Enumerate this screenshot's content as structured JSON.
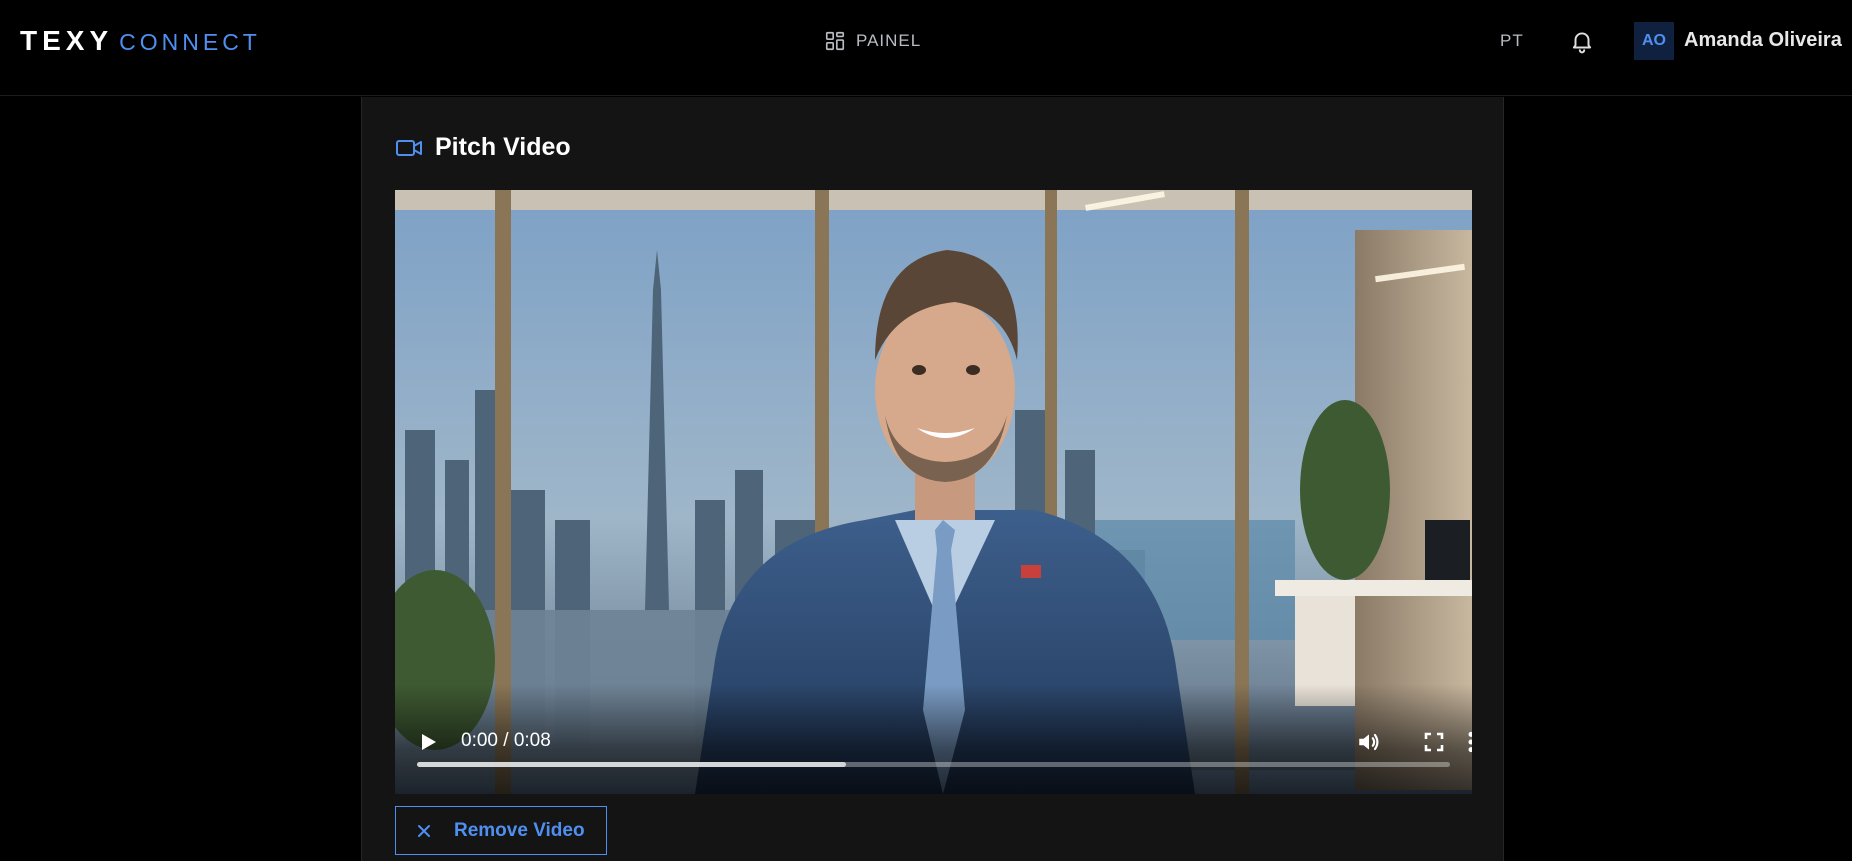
{
  "header": {
    "logo_brand": "TEXY",
    "logo_product": "CONNECT",
    "nav_panel_label": "PAINEL",
    "language": "PT",
    "user": {
      "initials": "AO",
      "name": "Amanda Oliveira"
    }
  },
  "section": {
    "title": "Pitch Video",
    "icon": "video-camera-icon"
  },
  "video": {
    "time_display": "0:00 / 0:08",
    "buffered_fraction": 0.415,
    "icons": [
      "play-icon",
      "volume-icon",
      "fullscreen-icon",
      "more-options-icon"
    ]
  },
  "actions": {
    "remove_label": "Remove Video",
    "remove_icon": "close-icon"
  },
  "colors": {
    "accent": "#4f8ff0",
    "background": "#000000",
    "panel": "#141414",
    "avatar_bg": "#10213f"
  }
}
